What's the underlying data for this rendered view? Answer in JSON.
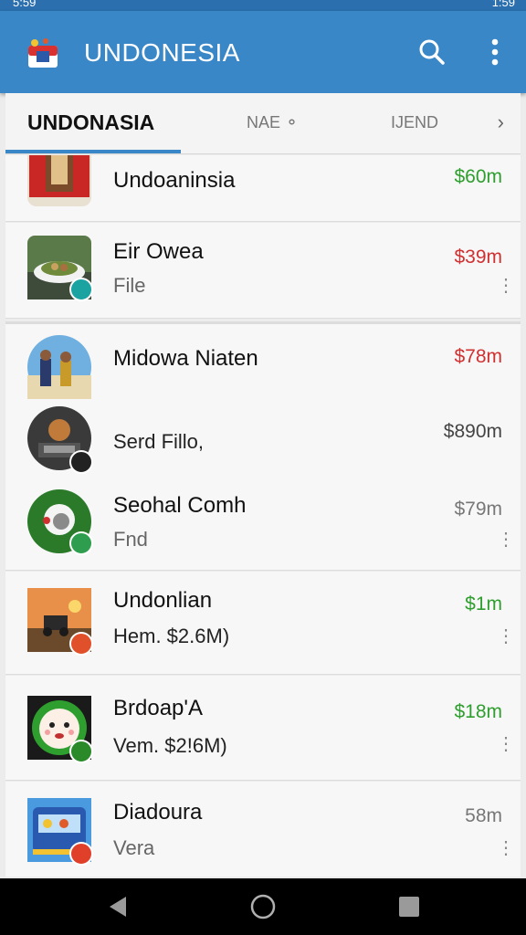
{
  "status": {
    "time": "5:59",
    "clock_right": "1:59"
  },
  "app": {
    "title": "UNDONESIA"
  },
  "tabs": [
    {
      "label": "UNDONASIA"
    },
    {
      "label": "NAE ⚬"
    },
    {
      "label": "IJEND"
    }
  ],
  "rows": [
    {
      "title": "Undoaninsia",
      "subtitle": "",
      "price": "$60m",
      "price_color": "#2e9e2e"
    },
    {
      "title": "Eir Owea",
      "subtitle": "File",
      "price": "$39m",
      "price_color": "#d03030"
    },
    {
      "title": "Midowa Niaten",
      "subtitle": "Serd Fillo,",
      "price": "$78m",
      "price2": "$890m",
      "price_color": "#d03030"
    },
    {
      "title": "Seohal Comh",
      "subtitle": "Fnd",
      "price": "$79m",
      "price_color": "#777777"
    },
    {
      "title": "Undonlian",
      "subtitle": "Hem. $2.6M)",
      "price": "$1m",
      "price_color": "#2e9e2e"
    },
    {
      "title": "Brdoap'A",
      "subtitle": "Vem. $2!6M)",
      "price": "$18m",
      "price_color": "#2e9e2e"
    },
    {
      "title": "Diadoura",
      "subtitle": "Vera",
      "price": "58m",
      "price_color": "#777777"
    }
  ],
  "icons": {
    "logo": "flag-logo-icon",
    "search": "search-icon",
    "more": "more-vert-icon",
    "next": "chevron-right-icon",
    "back": "nav-back-icon",
    "home": "nav-home-icon",
    "recents": "nav-recents-icon"
  },
  "colors": {
    "appbar": "#3a87c8",
    "accent": "#3a87c8",
    "green": "#2e9e2e",
    "red": "#d03030"
  }
}
